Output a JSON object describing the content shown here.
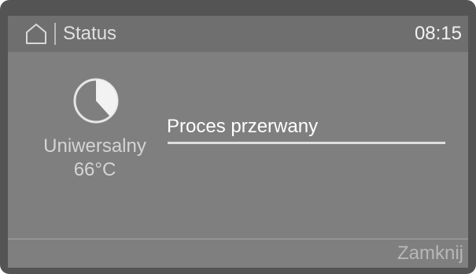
{
  "header": {
    "title": "Status",
    "time": "08:15"
  },
  "program": {
    "name": "Uniwersalny",
    "temperature": "66°C",
    "icon": "pie-progress-icon"
  },
  "status": {
    "message": "Proces przerwany"
  },
  "footer": {
    "close_label": "Zamknij"
  },
  "icons": {
    "home": "home-icon",
    "program": "pie-progress-icon"
  },
  "colors": {
    "screen_bg": "#7f7f7f",
    "header_bg": "#6f6f6f",
    "frame": "#545454",
    "text": "#d4d4d4",
    "highlight_text": "#ffffff"
  }
}
